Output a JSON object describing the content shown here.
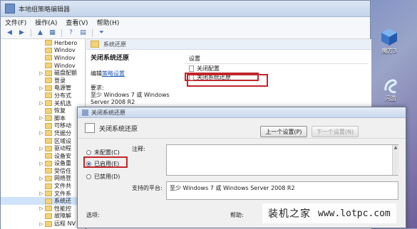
{
  "window": {
    "title": "本地组策略编辑器"
  },
  "menu": [
    "文件(F)",
    "操作(A)",
    "查看(V)",
    "帮助(H)"
  ],
  "toolbar": {
    "back": "◀",
    "forward": "▶",
    "up": "▲",
    "show": "▦",
    "help": "?",
    "props": "▤",
    "filter": "⏷"
  },
  "tree": [
    "Herbero",
    "Windov",
    "Windov",
    "Windov",
    "磁盘配额",
    "登录",
    "电源管",
    "分布式",
    "关机选",
    "恢复",
    "脚本",
    "可移动",
    "凭据分",
    "区域设",
    "驱动程",
    "设备安",
    "设备重",
    "受信任",
    "网络登",
    "文件共",
    "文件系",
    "系统还",
    "性能控",
    "故障解",
    "远程 NV"
  ],
  "tree_selected_index": 21,
  "right": {
    "node_title": "系统还原",
    "desc_title": "关闭系统还原",
    "edit_prefix": "编辑",
    "edit_link": "策略设置",
    "req_label": "要求:",
    "req_text": "至少 Windows 7 或 Windows Server 2008 R2",
    "list_header": "设置",
    "items": [
      "关闭配置",
      "关闭系统还原"
    ]
  },
  "dialog": {
    "title": "关闭系统还原",
    "policy_name": "关闭系统还原",
    "prev_button": "上一个设置(P)",
    "next_button": "下一个设置(N)",
    "options": [
      "未配置(C)",
      "已启用(E)",
      "已禁用(D)"
    ],
    "selected_option": 1,
    "comment_label": "注释:",
    "platform_label": "支持的平台:",
    "platform_value": "至少 Windows 7 或 Windows Server 2008 R2",
    "options_label": "选项:",
    "help_label": "帮助:"
  },
  "desktop": {
    "icon1_label": "魔方3",
    "icon2_label": "闪游"
  },
  "watermark": {
    "brand": "装机之家",
    "site": "www.lotpc.com"
  },
  "colors": {
    "highlight_red": "#c0262b",
    "link_blue": "#1f58b5"
  }
}
